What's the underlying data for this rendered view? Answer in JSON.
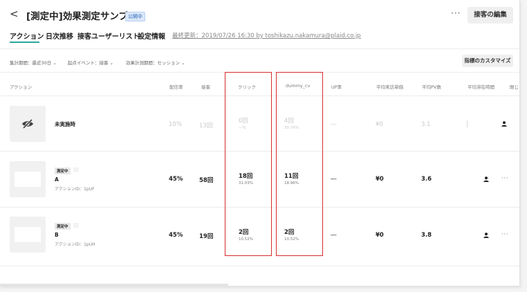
{
  "header": {
    "back_icon": "chevron-left-icon",
    "title": "[測定中]効果測定サンプル",
    "status_badge": "公開中",
    "more_label": "···",
    "edit_button": "接客の編集"
  },
  "tabs": [
    {
      "label": "アクション",
      "active": true
    },
    {
      "label": "日次推移",
      "active": false
    },
    {
      "label": "接客ユーザーリスト",
      "active": false
    },
    {
      "label": "設定情報",
      "active": false
    }
  ],
  "last_updated": "最終更新：2019/07/26 16:30 by toshikazu.nakamura@plaid.co.jp",
  "filters": {
    "period": "集計期間：最近30日 ⌄",
    "origin_event": "起点イベント：接客 ⌄",
    "calc_period": "効果計測期間：セッション ⌄",
    "customize_button": "指標のカスタマイズ"
  },
  "table": {
    "headers": [
      "アクション",
      "配信率",
      "接客",
      "クリック",
      "dummy_cv",
      "UP率",
      "平均来訪単価",
      "平均PV数",
      "平均滞在時間",
      "閉じ"
    ],
    "rows": [
      {
        "name": "未実施時",
        "badge": "",
        "action_id": "",
        "rate": "10%",
        "served": "13回",
        "click": "0回",
        "click_sub": "―%",
        "dummy_cv": "4回",
        "dummy_cv_sub": "30.76%",
        "up_rate": "―",
        "avg_unit_price": "¥0",
        "avg_pv": "3.1",
        "avg_stay": "",
        "faded": true,
        "thumb_icon": "eye-slash-icon"
      },
      {
        "name": "A",
        "badge": "測定中",
        "action_id": "アクションID：1pUF",
        "rate": "45%",
        "served": "58回",
        "click": "18回",
        "click_sub": "31.03%",
        "dummy_cv": "11回",
        "dummy_cv_sub": "18.96%",
        "up_rate": "―",
        "avg_unit_price": "¥0",
        "avg_pv": "3.6",
        "avg_stay": "",
        "faded": false,
        "thumb_icon": ""
      },
      {
        "name": "B",
        "badge": "測定中",
        "action_id": "アクションID：1pUH",
        "rate": "45%",
        "served": "19回",
        "click": "2回",
        "click_sub": "10.52%",
        "dummy_cv": "2回",
        "dummy_cv_sub": "10.52%",
        "up_rate": "―",
        "avg_unit_price": "¥0",
        "avg_pv": "3.8",
        "avg_stay": "",
        "faded": false,
        "thumb_icon": ""
      }
    ],
    "row_more_label": "···"
  },
  "colors": {
    "accent_teal": "#2aa79b",
    "highlight_red": "#d82a2a",
    "status_blue": "#2e66b8"
  }
}
